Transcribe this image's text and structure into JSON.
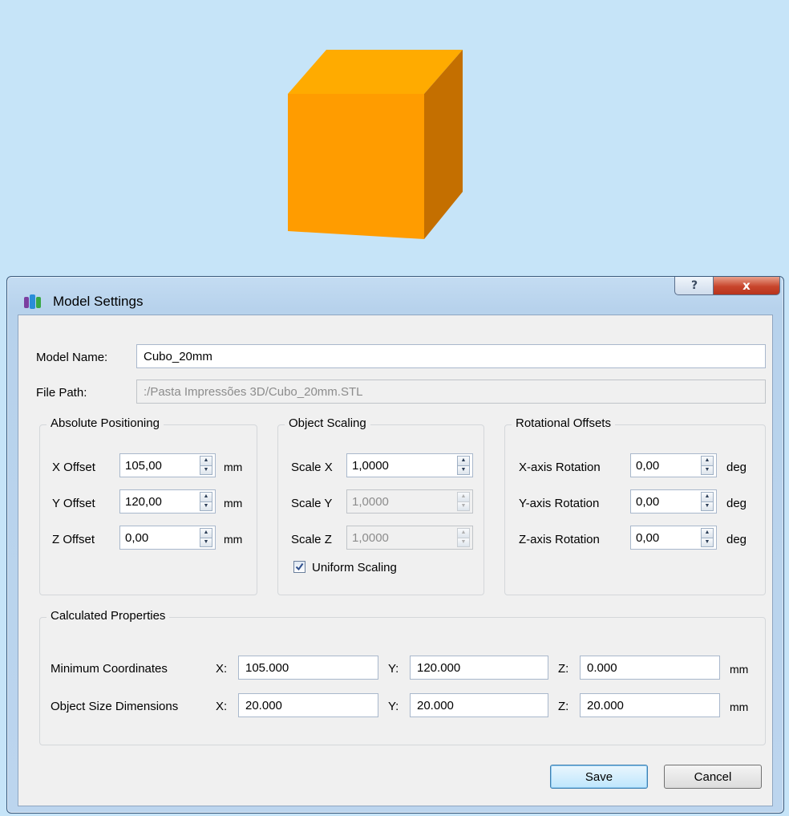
{
  "dialog": {
    "title": "Model Settings",
    "help_button": "?",
    "close_button": "x"
  },
  "model_name": {
    "label": "Model Name:",
    "value": "Cubo_20mm"
  },
  "file_path": {
    "label": "File Path:",
    "value": ":/Pasta Impressões 3D/Cubo_20mm.STL"
  },
  "absolute_positioning": {
    "title": "Absolute Positioning",
    "rows": [
      {
        "label": "X Offset",
        "value": "105,00",
        "unit": "mm"
      },
      {
        "label": "Y Offset",
        "value": "120,00",
        "unit": "mm"
      },
      {
        "label": "Z Offset",
        "value": "0,00",
        "unit": "mm"
      }
    ]
  },
  "object_scaling": {
    "title": "Object Scaling",
    "rows": [
      {
        "label": "Scale X",
        "value": "1,0000"
      },
      {
        "label": "Scale Y",
        "value": "1,0000"
      },
      {
        "label": "Scale Z",
        "value": "1,0000"
      }
    ],
    "uniform_label": "Uniform Scaling",
    "uniform_checked": true
  },
  "rotational_offsets": {
    "title": "Rotational Offsets",
    "rows": [
      {
        "label": "X-axis Rotation",
        "value": "0,00",
        "unit": "deg"
      },
      {
        "label": "Y-axis Rotation",
        "value": "0,00",
        "unit": "deg"
      },
      {
        "label": "Z-axis Rotation",
        "value": "0,00",
        "unit": "deg"
      }
    ]
  },
  "calculated": {
    "title": "Calculated Properties",
    "min": {
      "label": "Minimum Coordinates",
      "x_label": "X:",
      "x": "105.000",
      "y_label": "Y:",
      "y": "120.000",
      "z_label": "Z:",
      "z": "0.000",
      "unit": "mm"
    },
    "size": {
      "label": "Object Size Dimensions",
      "x_label": "X:",
      "x": "20.000",
      "y_label": "Y:",
      "y": "20.000",
      "z_label": "Z:",
      "z": "20.000",
      "unit": "mm"
    }
  },
  "buttons": {
    "save": "Save",
    "cancel": "Cancel"
  },
  "colors": {
    "viewport_bg": "#c6e4f8",
    "cube_top": "#ffab00",
    "cube_front": "#ff9c00",
    "cube_side": "#c46f00"
  }
}
